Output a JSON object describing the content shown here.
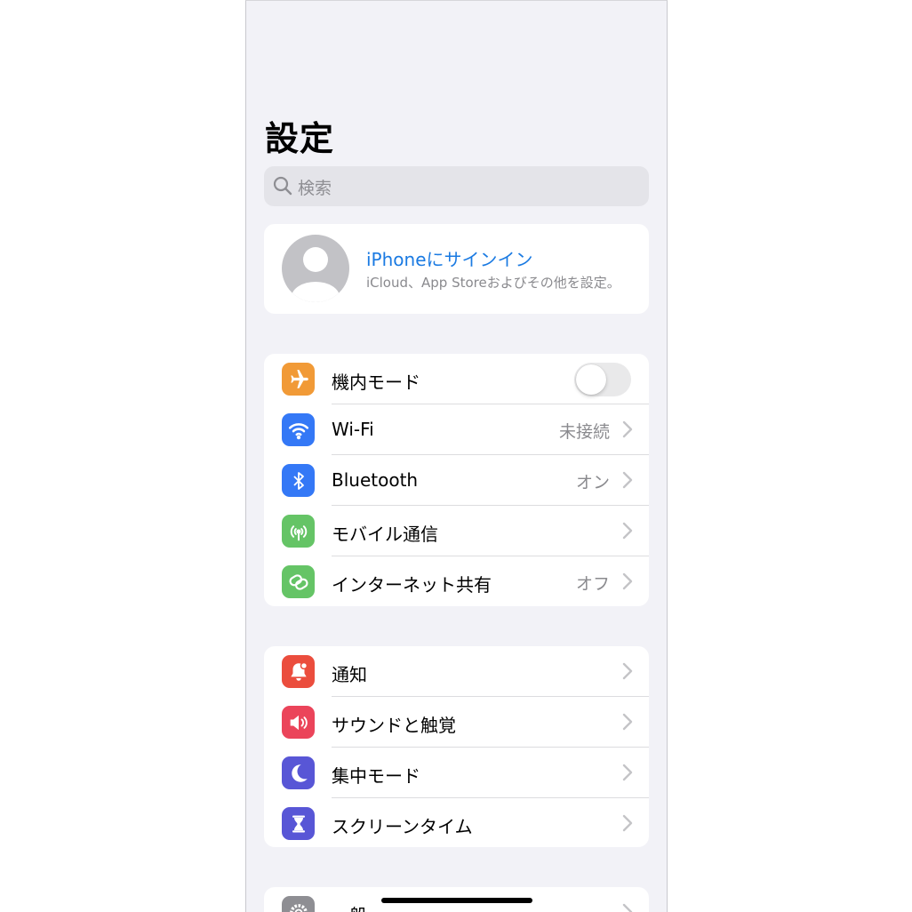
{
  "header": {
    "title": "設定"
  },
  "search": {
    "placeholder": "検索",
    "icon": "magnifier-icon"
  },
  "profile": {
    "title": "iPhoneにサインイン",
    "subtitle": "iCloud、App Storeおよびその他を設定。",
    "title_color": "#1a7ae2"
  },
  "connectivity": {
    "items": [
      {
        "label": "機内モード",
        "icon": "airplane-icon",
        "color": "#f19a37",
        "toggle": false
      },
      {
        "label": "Wi-Fi",
        "value": "未接続",
        "icon": "wifi-icon",
        "color": "#3478f6"
      },
      {
        "label": "Bluetooth",
        "value": "オン",
        "icon": "bluetooth-icon",
        "color": "#3478f6"
      },
      {
        "label": "モバイル通信",
        "icon": "antenna-icon",
        "color": "#65c466"
      },
      {
        "label": "インターネット共有",
        "value": "オフ",
        "icon": "link-icon",
        "color": "#65c466"
      }
    ]
  },
  "notifications": {
    "items": [
      {
        "label": "通知",
        "icon": "bell-icon",
        "color": "#eb4d3d"
      },
      {
        "label": "サウンドと触覚",
        "icon": "speaker-icon",
        "color": "#eb445a"
      },
      {
        "label": "集中モード",
        "icon": "moon-icon",
        "color": "#5856d6"
      },
      {
        "label": "スクリーンタイム",
        "icon": "hourglass-icon",
        "color": "#5856d6"
      }
    ]
  },
  "general": {
    "items": [
      {
        "label": "一般",
        "icon": "gear-icon",
        "color": "#8e8e93"
      }
    ]
  }
}
